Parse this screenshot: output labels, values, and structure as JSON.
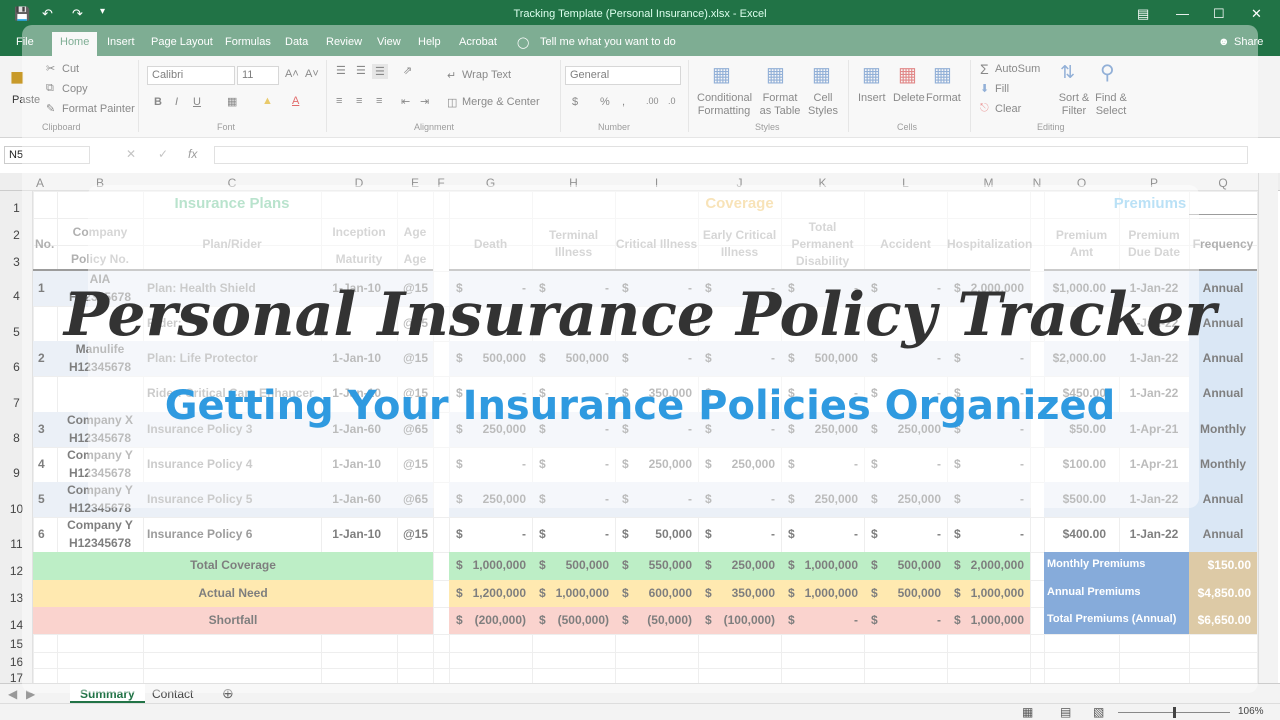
{
  "window": {
    "title": "Tracking Template (Personal Insurance).xlsx  -  Excel"
  },
  "ribbon_tabs": [
    {
      "label": "File"
    },
    {
      "label": "Home"
    },
    {
      "label": "Insert"
    },
    {
      "label": "Page Layout"
    },
    {
      "label": "Formulas"
    },
    {
      "label": "Data"
    },
    {
      "label": "Review"
    },
    {
      "label": "View"
    },
    {
      "label": "Help"
    },
    {
      "label": "Acrobat"
    }
  ],
  "tell_me": "Tell me what you want to do",
  "share": "Share",
  "ribbon": {
    "paste": "Paste",
    "cut": "Cut",
    "copy": "Copy",
    "format_painter": "Format Painter",
    "font_name": "Calibri",
    "font_size": "11",
    "wrap_text": "Wrap Text",
    "merge_center": "Merge & Center",
    "number_format": "General",
    "conditional_formatting": "Conditional Formatting",
    "format_as_table": "Format as Table",
    "cell_styles": "Cell Styles",
    "insert": "Insert",
    "delete": "Delete",
    "format": "Format",
    "autosum": "AutoSum",
    "fill": "Fill",
    "clear": "Clear",
    "sort_filter": "Sort & Filter",
    "find_select": "Find & Select",
    "groups": [
      "Clipboard",
      "Font",
      "Alignment",
      "Number",
      "Styles",
      "Cells",
      "Editing"
    ]
  },
  "name_box": "N5",
  "columns": [
    "A",
    "B",
    "C",
    "D",
    "E",
    "F",
    "G",
    "H",
    "I",
    "J",
    "K",
    "L",
    "M",
    "N",
    "O",
    "P",
    "Q"
  ],
  "rows": [
    "1",
    "2",
    "3",
    "4",
    "5",
    "6",
    "7",
    "8",
    "9",
    "10",
    "11",
    "12",
    "13",
    "14",
    "15",
    "16",
    "17"
  ],
  "sections": {
    "plans": "Insurance Plans",
    "coverage": "Coverage",
    "premiums": "Premiums"
  },
  "headers": {
    "no": "No.",
    "company": "Company",
    "policy_no": "Policy No.",
    "plan": "Plan/Rider",
    "inception": "Inception",
    "maturity": "Maturity",
    "age1": "Age",
    "age2": "Age",
    "death": "Death",
    "terminal": "Terminal Illness",
    "critical": "Critical Illness",
    "early_critical": "Early Critical Illness",
    "tpd": "Total Permanent Disability",
    "accident": "Accident",
    "hospitalization": "Hospitalization",
    "premium_amt": "Premium Amt",
    "premium_due": "Premium Due Date",
    "frequency": "Frequency"
  },
  "data_rows": [
    {
      "no": "1",
      "company": "AIA",
      "policy": "H12345678",
      "plan": "Plan: Health Shield",
      "date": "1-Jan-10",
      "age": "@15",
      "cov": [
        "-",
        "-",
        "-",
        "-",
        "-",
        "-",
        "2,000,000"
      ],
      "prem": "$1,000.00",
      "due": "1-Jan-22",
      "freq": "Annual"
    },
    {
      "no": "",
      "company": "",
      "policy": "",
      "plan": "Rider:",
      "date": "",
      "age": "@15",
      "cov": [
        "",
        "",
        "",
        "",
        "",
        "",
        ""
      ],
      "prem": "",
      "due": "1-Jan-22",
      "freq": "Annual"
    },
    {
      "no": "2",
      "company": "Manulife",
      "policy": "H12345678",
      "plan": "Plan: Life Protector",
      "date": "1-Jan-10",
      "age": "@15",
      "cov": [
        "500,000",
        "500,000",
        "-",
        "-",
        "500,000",
        "-",
        "-"
      ],
      "prem": "$2,000.00",
      "due": "1-Jan-22",
      "freq": "Annual"
    },
    {
      "no": "",
      "company": "",
      "policy": "",
      "plan": "Rider: Critical Care Enhancer",
      "date": "1-Jan-10",
      "age": "@15",
      "cov": [
        "-",
        "-",
        "350,000",
        "-",
        "-",
        "-",
        "-"
      ],
      "prem": "$450.00",
      "due": "1-Jan-22",
      "freq": "Annual"
    },
    {
      "no": "3",
      "company": "Company X",
      "policy": "H12345678",
      "plan": "Insurance Policy 3",
      "date": "1-Jan-60",
      "age": "@65",
      "cov": [
        "250,000",
        "-",
        "-",
        "-",
        "250,000",
        "250,000",
        "-"
      ],
      "prem": "$50.00",
      "due": "1-Apr-21",
      "freq": "Monthly"
    },
    {
      "no": "4",
      "company": "Company Y",
      "policy": "H12345678",
      "plan": "Insurance Policy 4",
      "date": "1-Jan-10",
      "age": "@15",
      "cov": [
        "-",
        "-",
        "250,000",
        "250,000",
        "-",
        "-",
        "-"
      ],
      "prem": "$100.00",
      "due": "1-Apr-21",
      "freq": "Monthly"
    },
    {
      "no": "5",
      "company": "Company Y",
      "policy": "H12345678",
      "plan": "Insurance Policy 5",
      "date": "1-Jan-60",
      "age": "@65",
      "cov": [
        "250,000",
        "-",
        "-",
        "-",
        "250,000",
        "250,000",
        "-"
      ],
      "prem": "$500.00",
      "due": "1-Jan-22",
      "freq": "Annual"
    },
    {
      "no": "6",
      "company": "Company Y",
      "policy": "H12345678",
      "plan": "Insurance Policy 6",
      "date": "1-Jan-10",
      "age": "@15",
      "cov": [
        "-",
        "-",
        "50,000",
        "-",
        "-",
        "-",
        "-"
      ],
      "prem": "$400.00",
      "due": "1-Jan-22",
      "freq": "Annual"
    }
  ],
  "summary": [
    {
      "label": "Total Coverage",
      "vals": [
        "1,000,000",
        "500,000",
        "550,000",
        "250,000",
        "1,000,000",
        "500,000",
        "2,000,000"
      ],
      "prem_label": "Monthly Premiums",
      "prem_val": "$150.00"
    },
    {
      "label": "Actual Need",
      "vals": [
        "1,200,000",
        "1,000,000",
        "600,000",
        "350,000",
        "1,000,000",
        "500,000",
        "1,000,000"
      ],
      "prem_label": "Annual Premiums",
      "prem_val": "$4,850.00"
    },
    {
      "label": "Shortfall",
      "vals": [
        "(200,000)",
        "(500,000)",
        "(50,000)",
        "(100,000)",
        "-",
        "-",
        "1,000,000"
      ],
      "prem_label": "Total Premiums (Annual)",
      "prem_val": "$6,650.00"
    }
  ],
  "sheet_tabs": [
    "Summary",
    "Contact"
  ],
  "zoom": "106%",
  "overlay": {
    "title": "Personal Insurance Policy Tracker",
    "subtitle": "Getting Your Insurance Policies Organized"
  },
  "colors": {
    "excel_green": "#217346",
    "band_blue": "#dce6f1",
    "total_green": "#8ee29e",
    "need_yellow": "#ffd978",
    "short_red": "#f7b3ab",
    "prem_blue": "#2f6fbf",
    "prem_tan": "#c5a467"
  }
}
